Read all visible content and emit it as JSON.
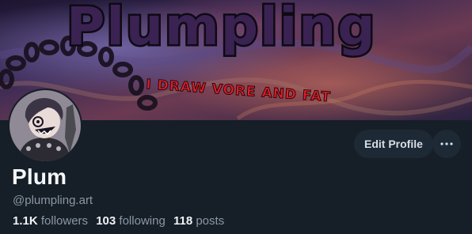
{
  "banner": {
    "title": "Plumpling",
    "tagline": "I DRAW VORE AND FAT"
  },
  "profile": {
    "display_name": "Plum",
    "handle": "@plumpling.art",
    "edit_label": "Edit Profile",
    "more_icon": "ellipsis-icon"
  },
  "stats": {
    "followers_count": "1.1K",
    "followers_label": "followers",
    "following_count": "103",
    "following_label": "following",
    "posts_count": "118",
    "posts_label": "posts"
  },
  "colors": {
    "background": "#161e27",
    "button_bg": "#1e2936",
    "muted_text": "#8b98a5",
    "tagline_red": "#e0202a"
  }
}
